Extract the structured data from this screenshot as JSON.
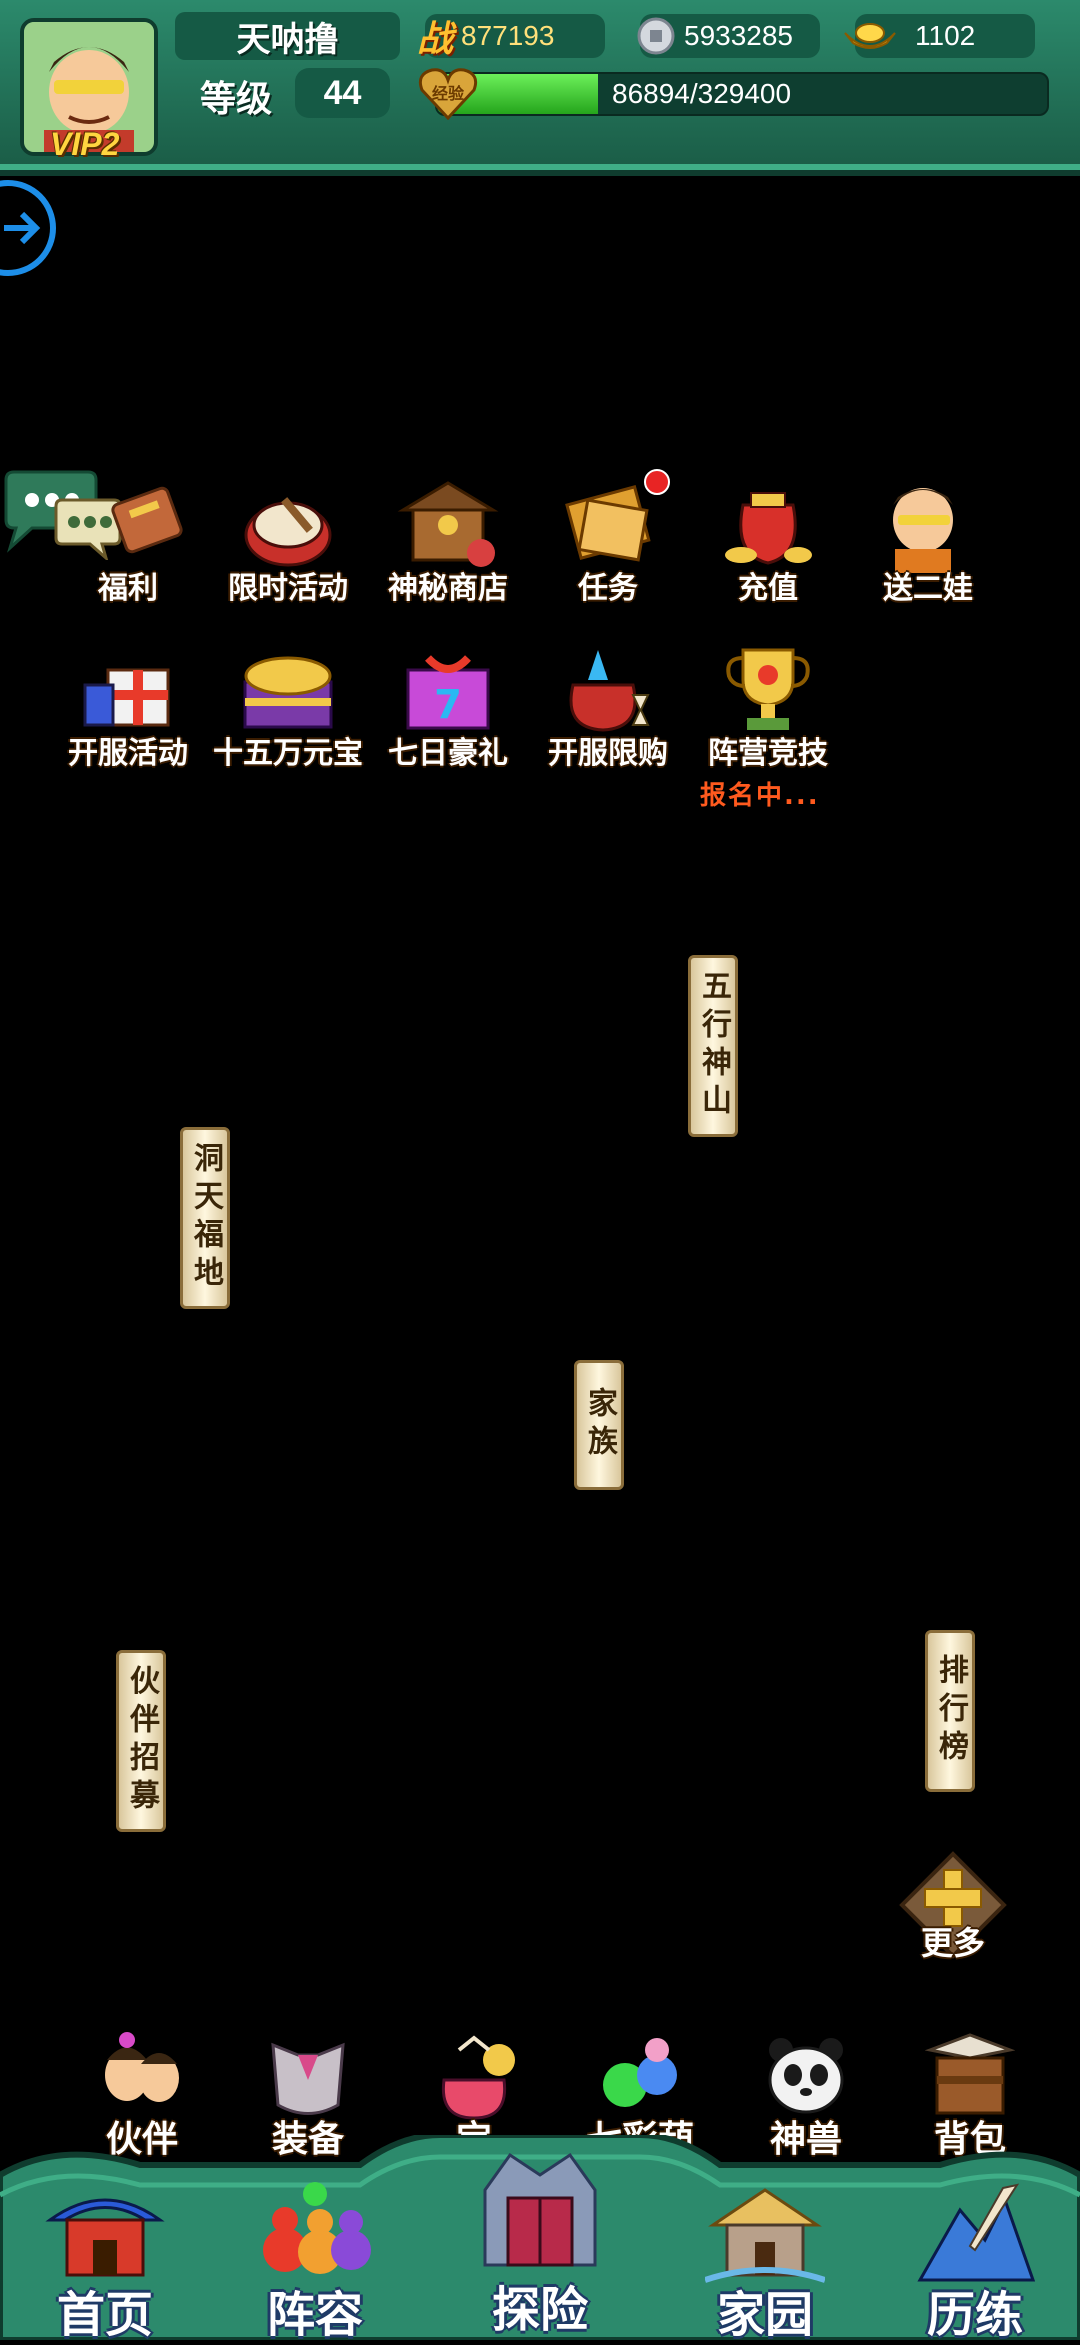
{
  "player": {
    "name": "天呐撸",
    "vip": "VIP2",
    "level_label": "等级",
    "level": "44"
  },
  "resources": {
    "power_glyph": "战",
    "power": "877193",
    "silver": "5933285",
    "gold": "1102"
  },
  "exp": {
    "label": "经验",
    "text": "86894/329400",
    "current": 86894,
    "max": 329400
  },
  "activities_row1": [
    {
      "label": "福利",
      "icon": "welfare-icon"
    },
    {
      "label": "限时活动",
      "icon": "drum-icon"
    },
    {
      "label": "神秘商店",
      "icon": "shop-icon"
    },
    {
      "label": "任务",
      "icon": "scroll-icon",
      "has_badge": true
    },
    {
      "label": "充值",
      "icon": "money-bag-icon"
    },
    {
      "label": "送二娃",
      "icon": "calabash-boy-icon"
    }
  ],
  "activities_row2": [
    {
      "label": "开服活动",
      "icon": "gift-box-icon"
    },
    {
      "label": "十五万元宝",
      "icon": "treasure-chest-icon"
    },
    {
      "label": "七日豪礼",
      "icon": "lucky-seven-icon"
    },
    {
      "label": "开服限购",
      "icon": "limited-bag-icon"
    },
    {
      "label": "阵营竞技",
      "icon": "trophy-icon",
      "status": "报名中..."
    }
  ],
  "map_signs": {
    "wuxing": "五行神山",
    "dongtian": "洞天福地",
    "family": "家族",
    "recruit": "伙伴招募",
    "ranking": "排行榜"
  },
  "more": "更多",
  "sub_nav": [
    {
      "label": "伙伴",
      "icon": "partner-icon"
    },
    {
      "label": "装备",
      "icon": "armor-icon"
    },
    {
      "label": "宝",
      "icon": "treasure-icon"
    },
    {
      "label": "七彩葫芦",
      "icon": "gourd-icon"
    },
    {
      "label": "神兽",
      "icon": "panda-icon"
    },
    {
      "label": "背包",
      "icon": "backpack-icon"
    }
  ],
  "main_nav": [
    {
      "label": "首页",
      "icon": "pagoda-icon"
    },
    {
      "label": "阵容",
      "icon": "gourds-icon"
    },
    {
      "label": "探险",
      "icon": "gate-icon"
    },
    {
      "label": "家园",
      "icon": "house-icon"
    },
    {
      "label": "历练",
      "icon": "mountain-sword-icon"
    }
  ],
  "colors": {
    "frame_green": "#2c8a6c",
    "frame_dark": "#155a45",
    "exp_fill": "#3ac22b",
    "status_orange": "#ff5a1e",
    "arrow_blue": "#1d8ee8"
  }
}
